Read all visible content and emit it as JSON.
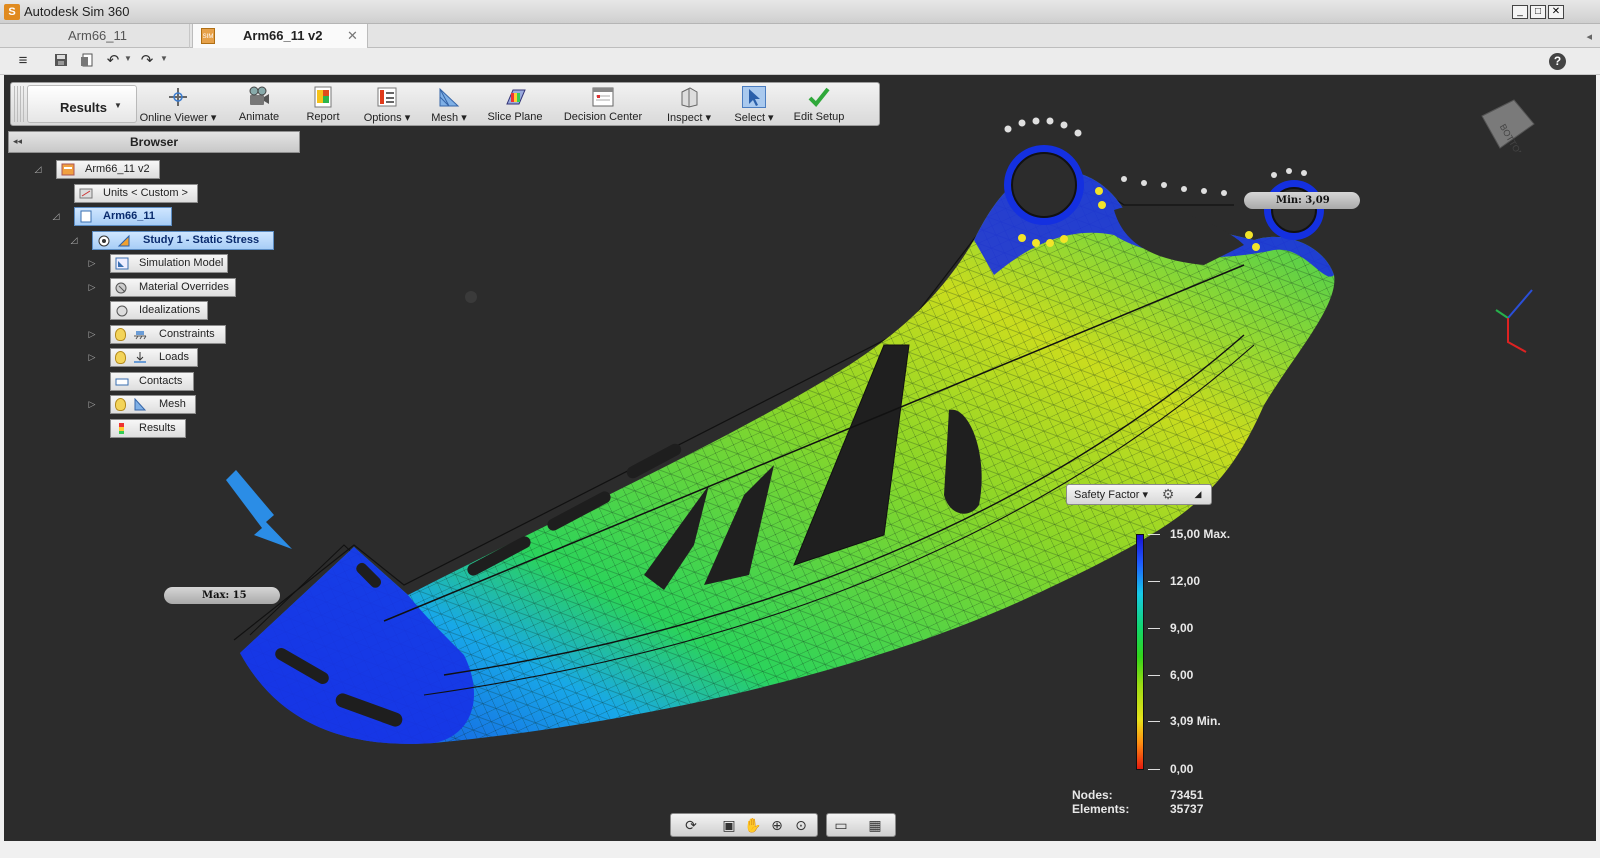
{
  "window": {
    "title": "Autodesk Sim 360",
    "logo": "S",
    "controls": [
      "_",
      "□",
      "✕"
    ]
  },
  "tabs": {
    "inactive": "Arm66_11",
    "active": "Arm66_11 v2",
    "close": "✕",
    "sim_icon": "SIM",
    "scroll": "◂"
  },
  "qat": {
    "icons": [
      "menu-icon",
      "save-icon",
      "save-all-icon",
      "undo-icon",
      "redo-icon"
    ],
    "help": "?"
  },
  "ribbon": {
    "tab_label": "Results",
    "tab_caret": "▼",
    "buttons": [
      {
        "label": "Online Viewer ▾",
        "icon": "online-viewer-icon"
      },
      {
        "label": "Animate",
        "icon": "animate-icon"
      },
      {
        "label": "Report",
        "icon": "report-icon"
      },
      {
        "label": "Options ▾",
        "icon": "options-icon"
      },
      {
        "label": "Mesh ▾",
        "icon": "mesh-icon"
      },
      {
        "label": "Slice Plane",
        "icon": "slice-plane-icon"
      },
      {
        "label": "Decision Center",
        "icon": "decision-center-icon"
      },
      {
        "label": "Inspect ▾",
        "icon": "inspect-icon"
      },
      {
        "label": "Select ▾",
        "icon": "select-icon"
      },
      {
        "label": "Edit Setup",
        "icon": "edit-setup-icon"
      }
    ]
  },
  "browser": {
    "title": "Browser",
    "collapse": "◂◂",
    "tree": {
      "root": "Arm66_11 v2",
      "units": "Units < Custom >",
      "model": "Arm66_11",
      "study": "Study 1 - Static Stress",
      "items": [
        "Simulation Model",
        "Material Overrides",
        "Idealizations",
        "Constraints",
        "Loads",
        "Contacts",
        "Mesh",
        "Results"
      ]
    },
    "glyphs": {
      "collapse_tri": "◿",
      "expand_tri": "▷"
    }
  },
  "legend": {
    "selector": "Safety Factor ▾",
    "collapse": "◢",
    "ticks": [
      "15,00 Max.",
      "12,00",
      "9,00",
      "6,00",
      "3,09 Min.",
      "0,00"
    ],
    "scale_colors": [
      "#1a10d0",
      "#17c9e8",
      "#13d76b",
      "#9bdc14",
      "#e8e21a",
      "#ff8d12",
      "#e41a0f"
    ]
  },
  "stats": {
    "nodes_label": "Nodes:",
    "nodes": "73451",
    "elements_label": "Elements:",
    "elements": "35737"
  },
  "probes": {
    "max": "Max: 15",
    "min": "Min: 3,09"
  },
  "viewcube": {
    "face": "BOTTOM"
  },
  "navbar": {
    "icons": [
      "orbit-icon",
      "look-at-icon",
      "pan-icon",
      "zoom-icon",
      "zoom-window-icon",
      "display-icon",
      "grid-icon"
    ]
  },
  "colors": {
    "viewport": "#2c2c2c",
    "accent_blue": "#2b8de6",
    "selected": "#a7cdf6"
  }
}
